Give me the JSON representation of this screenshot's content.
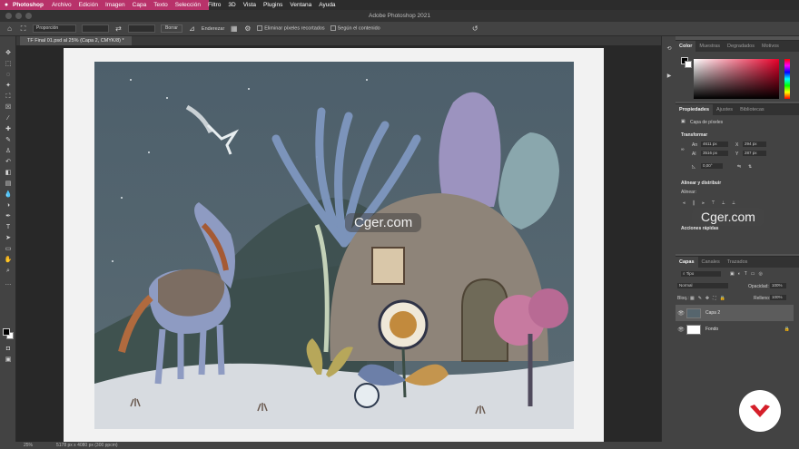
{
  "menubar": {
    "apple": "",
    "app": "Photoshop",
    "items": [
      "Archivo",
      "Edición",
      "Imagen",
      "Capa",
      "Texto",
      "Selección",
      "Filtro",
      "3D",
      "Vista",
      "Plugins",
      "Ventana",
      "Ayuda"
    ]
  },
  "window": {
    "title": "Adobe Photoshop 2021"
  },
  "options": {
    "mode_label": "Proporción",
    "clear_label": "Borrar",
    "straighten_label": "Enderezar",
    "delete_cropped_label": "Eliminar píxeles recortados",
    "content_aware_label": "Según el contenido"
  },
  "document": {
    "tab_label": "TF Final 01.psd al 25% (Capa 2, CMYK/8) *"
  },
  "status": {
    "zoom": "25%",
    "info": "5178 px x 4080 px (300 ppcm)"
  },
  "watermarks": [
    "Cger.com",
    "Cger.com"
  ],
  "color_panel": {
    "tabs": [
      "Color",
      "Muestras",
      "Degradados",
      "Motivos"
    ],
    "accent": "#e8002a"
  },
  "properties_panel": {
    "tabs": [
      "Propiedades",
      "Ajustes",
      "Bibliotecas"
    ],
    "kind": "Capa de píxeles",
    "transform_title": "Transformar",
    "w_label": "An",
    "w_value": "4611 px",
    "h_label": "Al",
    "h_value": "3516 px",
    "x_label": "X",
    "x_value": "294 px",
    "y_label": "Y",
    "y_value": "287 px",
    "angle_value": "0,00°",
    "align_title": "Alinear y distribuir",
    "align_sub": "Alinear:",
    "quick_actions": "Acciones rápidas"
  },
  "layers_panel": {
    "tabs": [
      "Capas",
      "Canales",
      "Trazados"
    ],
    "filter_label": "Tipo",
    "blend_mode": "Normal",
    "opacity_label": "Opacidad:",
    "opacity_value": "100%",
    "lock_label": "Bloq.:",
    "fill_label": "Relleno:",
    "fill_value": "100%",
    "layers": [
      {
        "name": "Capa 2",
        "selected": true
      },
      {
        "name": "Fondo",
        "selected": false
      }
    ]
  }
}
